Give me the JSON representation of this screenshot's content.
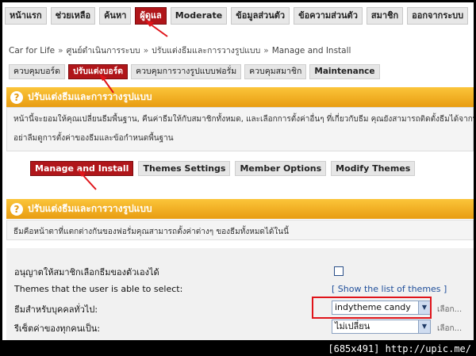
{
  "topnav": [
    "หน้าแรก",
    "ช่วยเหลือ",
    "ค้นหา",
    "ผู้ดูแล",
    "Moderate",
    "ข้อมูลส่วนตัว",
    "ข้อความส่วนตัว",
    "สมาชิก",
    "ออกจากระบบ"
  ],
  "breadcrumb": {
    "items": [
      "Car for Life",
      "ศูนย์ดำเนินการระบบ",
      "ปรับแต่งธีมและการวางรูปแบบ",
      "Manage and Install"
    ],
    "separator": "»"
  },
  "subnav": [
    "ควบคุมบอร์ด",
    "ปรับแต่งบอร์ด",
    "ควบคุมการวางรูปแบบฟอรั่ม",
    "ควบคุมสมาชิก",
    "Maintenance"
  ],
  "panel1": {
    "title": "ปรับแต่งธีมและการวางรูปแบบ",
    "line1": "หน้านี้จะยอมให้คุณเปลี่ยนธีมพื้นฐาน, คืนค่าธีมให้กับสมาชิกทั้งหมด, และเลือกการตั้งค่าอื่นๆ ที่เกี่ยวกับธีม คุณยังสามารถติดตั้งธีมได้จากที่นี่",
    "line2": "อย่าลืมดูการตั้งค่าของธีมและข้อกำหนดพื้นฐาน"
  },
  "tabs": [
    "Manage and Install",
    "Themes Settings",
    "Member Options",
    "Modify Themes"
  ],
  "panel2": {
    "title": "ปรับแต่งธีมและการวางรูปแบบ",
    "desc": "ธีมคือหน้าตาที่แตกต่างกันของฟอรั่มคุณสามารถตั้งค่าต่างๆ ของธีมทั้งหมดได้ในนี้"
  },
  "form": {
    "allow_label": "อนุญาตให้สมาชิกเลือกธีมของตัวเองได้",
    "selectable_label": "Themes that the user is able to select:",
    "selectable_link": "[ Show the list of themes ]",
    "guest_label": "ธีมสำหรับบุคคลทั่วไป:",
    "guest_value": "indytheme candy",
    "reset_label": "รีเซ็ตค่าของทุกคนเป็น:",
    "reset_value": "ไม่เปลี่ยน",
    "more_label": "เลือก..."
  },
  "footer": "[685x491] http://upic.me/",
  "colors": {
    "active": "#b0161a",
    "header_orange": "#f0a81e",
    "annotation_red": "#e0141a",
    "link": "#1f4e9a"
  }
}
